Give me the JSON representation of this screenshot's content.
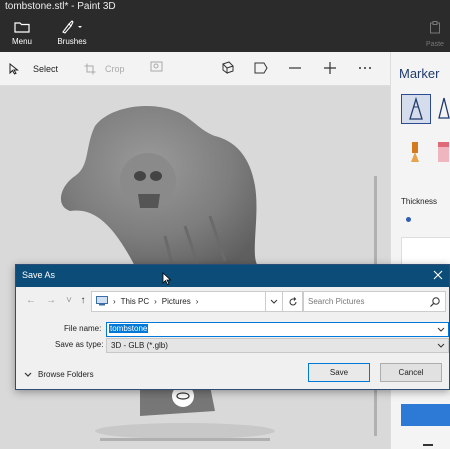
{
  "window": {
    "title": "tombstone.stl* - Paint 3D"
  },
  "ribbon": {
    "menu_label": "Menu",
    "brushes_label": "Brushes",
    "paste_label": "Paste"
  },
  "toolbar": {
    "select_label": "Select",
    "crop_label": "Crop"
  },
  "side_panel": {
    "title": "Marker",
    "thickness_label": "Thickness",
    "accent_color": "#1f3a6d"
  },
  "save_dialog": {
    "title": "Save As",
    "breadcrumb": [
      "This PC",
      "Pictures"
    ],
    "search_placeholder": "Search Pictures",
    "file_name_label": "File name:",
    "file_name_value": "tombstone",
    "save_type_label": "Save as type:",
    "save_type_value": "3D - GLB (*.glb)",
    "browse_folders_label": "Browse Folders",
    "save_button": "Save",
    "cancel_button": "Cancel",
    "title_bar_color": "#0b4d78"
  }
}
